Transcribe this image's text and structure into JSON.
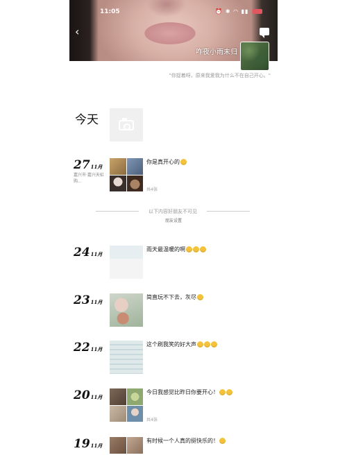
{
  "status_bar": {
    "time": "11:05"
  },
  "profile": {
    "nickname": "咋夜小雨未归",
    "signature": "\"你捉着呀，原来我爱我为什么不在自己开心。\""
  },
  "today": {
    "label": "今天"
  },
  "hidden_notice": {
    "text": "以下内容好朋友不可见",
    "sub": "朋友设置"
  },
  "entries": [
    {
      "day": "27",
      "month": "11月",
      "location": "嘉兴市·嘉兴天虹购...",
      "text": "你是真开心的",
      "emojis": 1,
      "count": "共4张",
      "thumbs": [
        "#c9a46a",
        "#7e97b5",
        "#d6c7c2",
        "#6b4b3c"
      ]
    },
    {
      "day": "24",
      "month": "11月",
      "location": "",
      "text": "雨天最温暖的啊",
      "emojis": 3,
      "count": "",
      "thumbs": [
        "#e7eef2"
      ]
    },
    {
      "day": "23",
      "month": "11月",
      "location": "",
      "text": "简直玩不下去，灰尽",
      "emojis": 1,
      "count": "",
      "thumbs": [
        "#cfd6cc"
      ]
    },
    {
      "day": "22",
      "month": "11月",
      "location": "",
      "text": "这个刷我笑的好大声",
      "emojis": 3,
      "count": "",
      "thumbs": [
        "#dfe9ea"
      ]
    },
    {
      "day": "20",
      "month": "11月",
      "location": "",
      "text": "今日我感觉比昨日你要开心！",
      "emojis": 2,
      "count": "共4张",
      "thumbs": [
        "#7d6958",
        "#8fa86f",
        "#c9b9a6",
        "#6d8faa"
      ]
    },
    {
      "day": "19",
      "month": "11月",
      "location": "",
      "text": "有时候一个人真的挺快乐的！",
      "emojis": 1,
      "count": "",
      "thumbs": [
        "#9a7c66",
        "#c2a891"
      ]
    }
  ],
  "colors": {
    "battery": "#e0575f",
    "emoji": "#f5c33b"
  }
}
